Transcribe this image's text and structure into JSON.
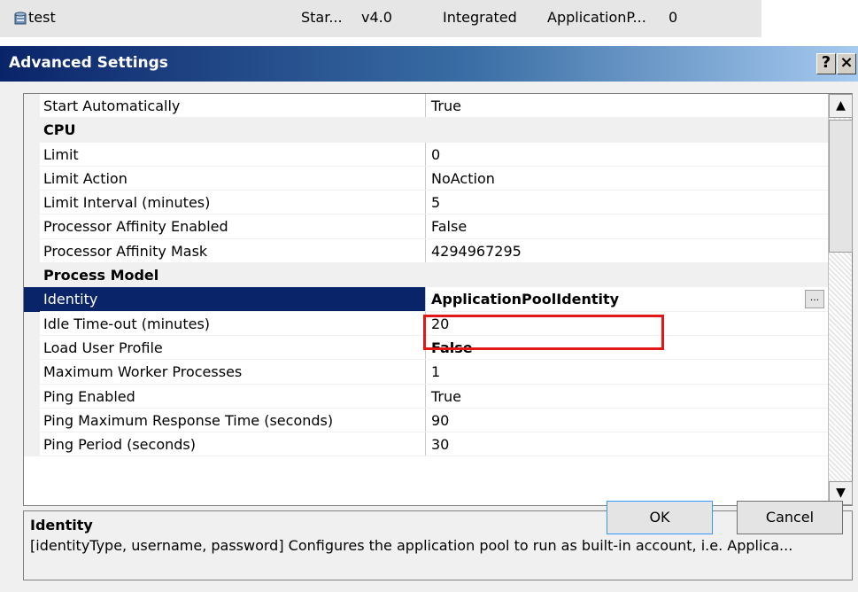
{
  "background_row": {
    "name": "test",
    "status": "Star...",
    "framework": "v4.0",
    "pipeline": "Integrated",
    "identity": "ApplicationP...",
    "applications": "0"
  },
  "dialog": {
    "title": "Advanced Settings",
    "help_label": "?",
    "close_label": "×"
  },
  "grid": {
    "rows": [
      {
        "type": "prop",
        "name": "Start Automatically",
        "value": "True"
      },
      {
        "type": "cat",
        "name": "CPU",
        "expander": "⊟"
      },
      {
        "type": "prop",
        "name": "Limit",
        "value": "0"
      },
      {
        "type": "prop",
        "name": "Limit Action",
        "value": "NoAction"
      },
      {
        "type": "prop",
        "name": "Limit Interval (minutes)",
        "value": "5"
      },
      {
        "type": "prop",
        "name": "Processor Affinity Enabled",
        "value": "False"
      },
      {
        "type": "prop",
        "name": "Processor Affinity Mask",
        "value": "4294967295"
      },
      {
        "type": "cat",
        "name": "Process Model",
        "expander": "⊟"
      },
      {
        "type": "prop",
        "name": "Identity",
        "value": "ApplicationPoolIdentity",
        "selected": true,
        "bold": true,
        "button": "..."
      },
      {
        "type": "prop",
        "name": "Idle Time-out (minutes)",
        "value": "20"
      },
      {
        "type": "prop",
        "name": "Load User Profile",
        "value": "False",
        "bold": true
      },
      {
        "type": "prop",
        "name": "Maximum Worker Processes",
        "value": "1"
      },
      {
        "type": "prop",
        "name": "Ping Enabled",
        "value": "True"
      },
      {
        "type": "prop",
        "name": "Ping Maximum Response Time (seconds)",
        "value": "90"
      },
      {
        "type": "prop",
        "name": "Ping Period (seconds)",
        "value": "30"
      }
    ],
    "scroll_up": "▲",
    "scroll_down": "▼"
  },
  "description": {
    "title": "Identity",
    "text": "[identityType, username, password] Configures the application pool to run as built-in account, i.e. Applica..."
  },
  "buttons": {
    "ok": "OK",
    "cancel": "Cancel"
  },
  "colors": {
    "selection": "#0a246a",
    "highlight_box": "#e01818"
  }
}
